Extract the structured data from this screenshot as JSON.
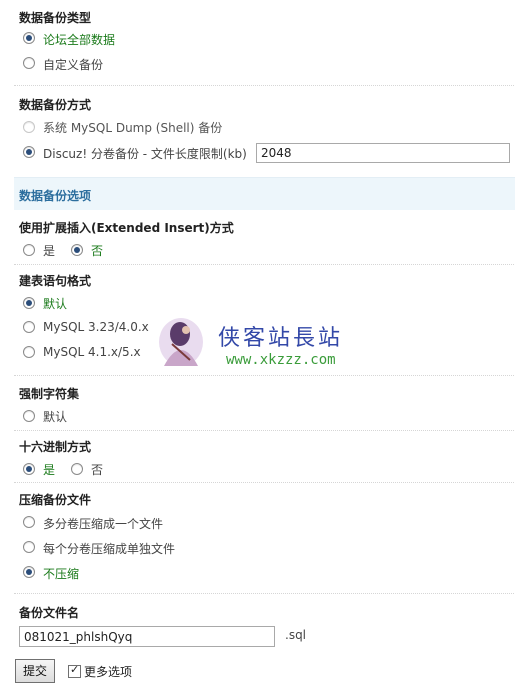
{
  "backup_type": {
    "heading": "数据备份类型",
    "options": [
      "论坛全部数据",
      "自定义备份"
    ],
    "selected": 0
  },
  "backup_method": {
    "heading": "数据备份方式",
    "options": [
      "系统 MySQL Dump (Shell) 备份",
      "Discuz! 分卷备份 - 文件长度限制(kb)"
    ],
    "selected": 1,
    "size_limit_value": "2048"
  },
  "options_section": {
    "title": "数据备份选项"
  },
  "extended_insert": {
    "heading": "使用扩展插入(Extended Insert)方式",
    "options": [
      "是",
      "否"
    ],
    "selected": 1
  },
  "create_table_format": {
    "heading": "建表语句格式",
    "options": [
      "默认",
      "MySQL 3.23/4.0.x",
      "MySQL 4.1.x/5.x"
    ],
    "selected": 0
  },
  "force_charset": {
    "heading": "强制字符集",
    "options": [
      "默认"
    ]
  },
  "hex": {
    "heading": "十六进制方式",
    "options": [
      "是",
      "否"
    ],
    "selected": 0
  },
  "compress": {
    "heading": "压缩备份文件",
    "options": [
      "多分卷压缩成一个文件",
      "每个分卷压缩成单独文件",
      "不压缩"
    ],
    "selected": 2
  },
  "filename": {
    "heading": "备份文件名",
    "value": "081021_phlshQyq",
    "extension": ".sql"
  },
  "footer": {
    "submit_label": "提交",
    "more_options_label": "更多选项",
    "more_options_checked": true
  },
  "watermark": {
    "text_cn": "侠客站長站",
    "url": "www.xkzzz.com"
  },
  "colors": {
    "active_option": "#1a7a1a",
    "section_band": "#edf6fb",
    "section_title": "#2c6e9e"
  }
}
